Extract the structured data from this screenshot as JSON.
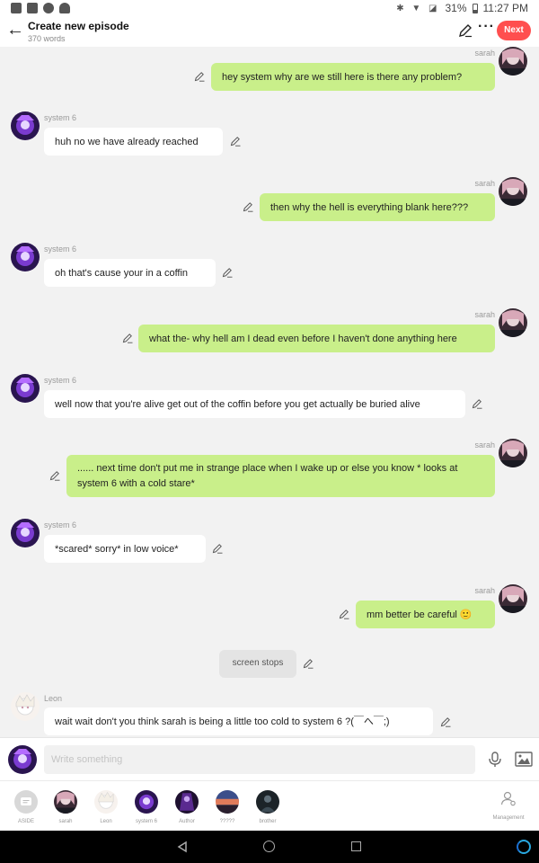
{
  "status_bar": {
    "battery": "31%",
    "time": "11:27 PM"
  },
  "header": {
    "title": "Create new episode",
    "word_count": "370 words",
    "next_label": "Next"
  },
  "messages": [
    {
      "speaker": "sarah",
      "side": "right",
      "text": "hey system why are we still here is there any problem?"
    },
    {
      "speaker": "system 6",
      "side": "left",
      "text": "huh no we have already reached"
    },
    {
      "speaker": "sarah",
      "side": "right",
      "text": "then why the hell is everything blank here???"
    },
    {
      "speaker": "system 6",
      "side": "left",
      "text": "oh that's cause your in a coffin"
    },
    {
      "speaker": "sarah",
      "side": "right",
      "text": "what the- why hell am I dead even before I haven't done anything here"
    },
    {
      "speaker": "system 6",
      "side": "left",
      "text": "well now that you're alive get out of the coffin before you get actually be buried alive"
    },
    {
      "speaker": "sarah",
      "side": "right",
      "text": "...... next time don't put me in strange place when I wake up or else you know * looks at system 6 with a cold stare*"
    },
    {
      "speaker": "system 6",
      "side": "left",
      "text": "*scared* sorry* in low voice*"
    },
    {
      "speaker": "sarah",
      "side": "right",
      "text": "mm better be careful 🙂"
    },
    {
      "speaker": "",
      "side": "center",
      "text": "screen stops"
    },
    {
      "speaker": "Leon",
      "side": "left",
      "text": "wait wait don't you think sarah is being a little too cold to system 6 ?(￣へ￣;)"
    }
  ],
  "input": {
    "placeholder": "Write something"
  },
  "characters": [
    {
      "label": "ASIDE",
      "icon": "aside-icon"
    },
    {
      "label": "sarah",
      "icon": "sarah-avatar"
    },
    {
      "label": "Leon",
      "icon": "leon-avatar"
    },
    {
      "label": "system 6",
      "icon": "system6-avatar"
    },
    {
      "label": "Author",
      "icon": "author-avatar"
    },
    {
      "label": "?????",
      "icon": "sunset-avatar"
    },
    {
      "label": "brother",
      "icon": "brother-avatar"
    }
  ],
  "management_label": "Management",
  "colors": {
    "accent": "#ff4f4f",
    "my_bubble": "#c9ef8a",
    "other_bubble": "#ffffff",
    "assistant": "#29a8e0"
  }
}
